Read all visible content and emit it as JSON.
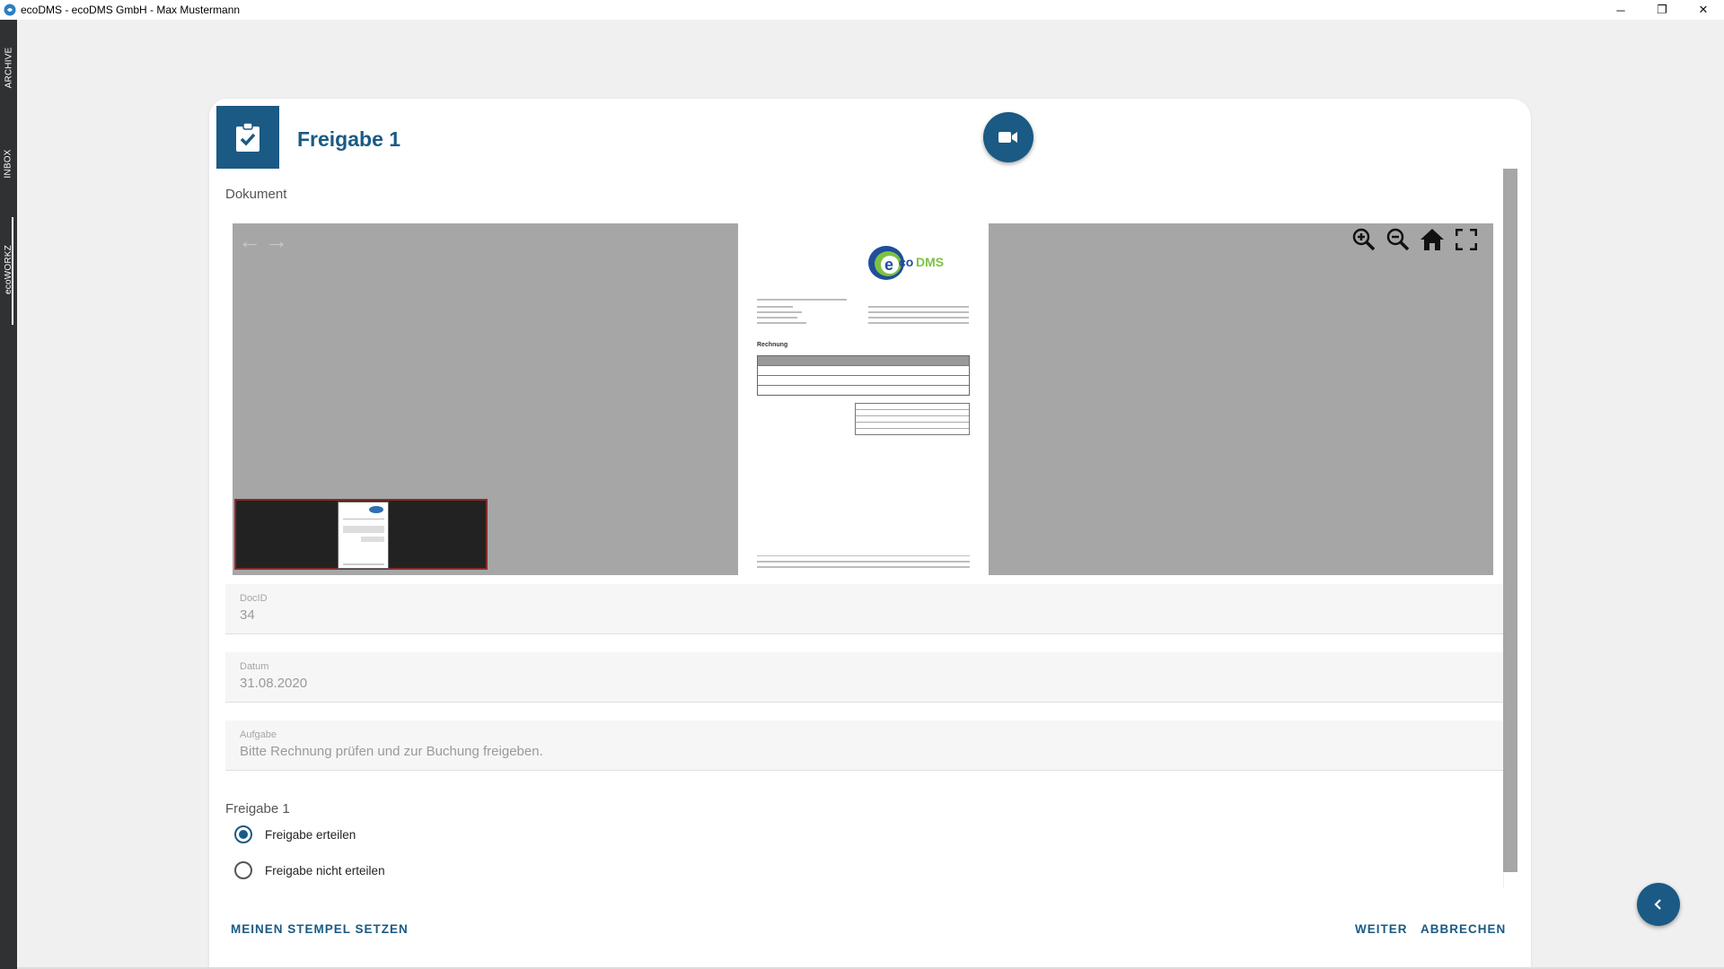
{
  "window": {
    "title": "ecoDMS - ecoDMS GmbH - Max Mustermann",
    "controls": {
      "minimize": "─",
      "restore": "❐",
      "close": "✕"
    }
  },
  "sidenav": {
    "items": [
      {
        "label": "ARCHIVE"
      },
      {
        "label": "INBOX"
      },
      {
        "label": "ecoWORKZ"
      }
    ]
  },
  "dialog": {
    "title": "Freigabe 1",
    "document_label": "Dokument",
    "viewer": {
      "prev": "←",
      "next": "→",
      "tools": [
        "zoom-in",
        "zoom-out",
        "home",
        "fullscreen"
      ],
      "page": {
        "logo_text": "ecoDMS",
        "heading": "Rechnung"
      }
    },
    "fields": [
      {
        "label": "DocID",
        "value": "34"
      },
      {
        "label": "Datum",
        "value": "31.08.2020"
      },
      {
        "label": "Aufgabe",
        "value": "Bitte Rechnung prüfen und zur Buchung freigeben."
      }
    ],
    "approval": {
      "label": "Freigabe 1",
      "options": [
        {
          "label": "Freigabe erteilen",
          "selected": true
        },
        {
          "label": "Freigabe nicht erteilen",
          "selected": false
        }
      ]
    },
    "actions": {
      "stamp": "MEINEN STEMPEL SETZEN",
      "next": "WEITER",
      "cancel": "ABBRECHEN"
    }
  },
  "colors": {
    "accent": "#1a5a84",
    "sidebar": "#2f3133",
    "viewer_bg": "#a6a6a6"
  }
}
